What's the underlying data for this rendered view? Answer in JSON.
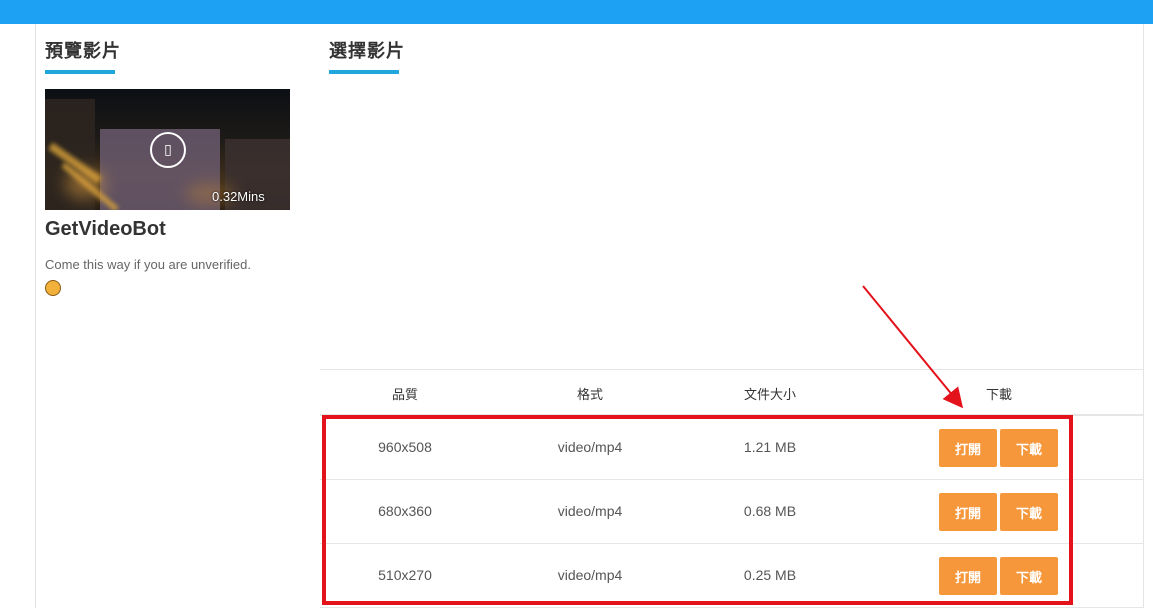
{
  "colors": {
    "top_bar": "#1da1f2",
    "accent_line": "#1ea6dd",
    "button": "#f5973a",
    "annotation": "#e3121b"
  },
  "preview": {
    "heading": "預覽影片",
    "duration": "0.32Mins",
    "play_icon": "play-icon",
    "title": "GetVideoBot",
    "description": "Come this way if you are unverified.",
    "emoji_icon": "hand-emoji-icon"
  },
  "select": {
    "heading": "選擇影片",
    "columns": [
      "品質",
      "格式",
      "文件大小",
      "下載"
    ],
    "rows": [
      {
        "quality": "960x508",
        "format": "video/mp4",
        "size": "1.21 MB",
        "open": "打開",
        "download": "下載"
      },
      {
        "quality": "680x360",
        "format": "video/mp4",
        "size": "0.68 MB",
        "open": "打開",
        "download": "下載"
      },
      {
        "quality": "510x270",
        "format": "video/mp4",
        "size": "0.25 MB",
        "open": "打開",
        "download": "下載"
      }
    ]
  }
}
